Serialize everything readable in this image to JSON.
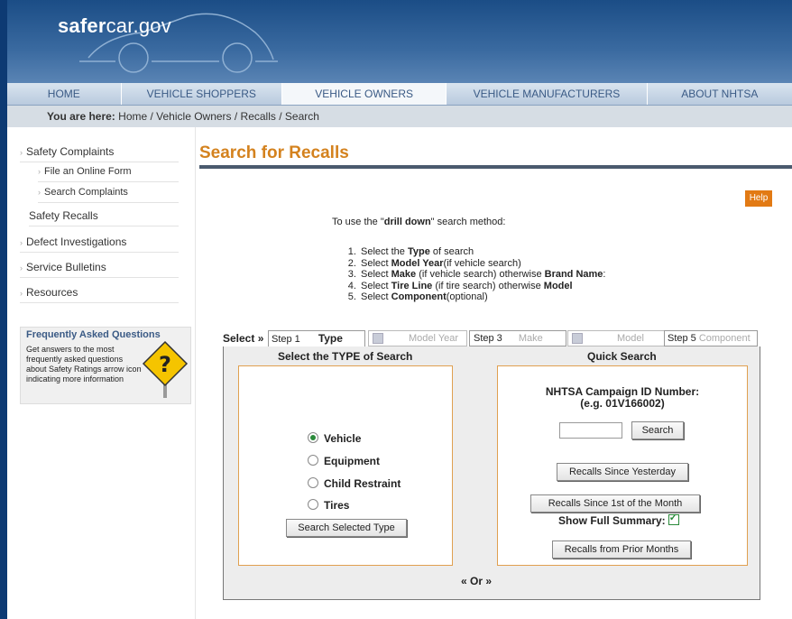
{
  "logo": {
    "bold": "safer",
    "rest": "car.gov"
  },
  "nav": [
    "HOME",
    "VEHICLE SHOPPERS",
    "VEHICLE OWNERS",
    "VEHICLE MANUFACTURERS",
    "ABOUT NHTSA"
  ],
  "breadcrumb": {
    "prefix": "You are here:",
    "path": "Home / Vehicle Owners / Recalls / Search"
  },
  "sidebar": {
    "items": [
      "Safety Complaints",
      "File an Online Form",
      "Search Complaints",
      "Safety Recalls",
      "Defect Investigations",
      "Service Bulletins",
      "Resources"
    ]
  },
  "faq": {
    "title": "Frequently Asked Questions",
    "text": "Get answers to the most frequently asked questions about Safety Ratings arrow icon indicating more information"
  },
  "page": {
    "title": "Search for Recalls",
    "help": "Help",
    "intro": {
      "before": "To use the \"",
      "bold": "drill down",
      "after": "\" search method:"
    },
    "steps": [
      [
        "Select the ",
        "Type",
        " of search"
      ],
      [
        "Select ",
        "Model Year",
        "(if vehicle search)"
      ],
      [
        "Select ",
        "Make",
        " (if vehicle search) otherwise ",
        "Brand Name",
        ":"
      ],
      [
        "Select ",
        "Tire Line",
        " (if tire search) otherwise ",
        "Model"
      ],
      [
        "Select ",
        "Component",
        "(optional)"
      ]
    ]
  },
  "wizard": {
    "select_label": "Select »",
    "tabs": {
      "step1": "Step 1",
      "type": "Type",
      "model_year": "Model Year",
      "step3": "Step 3",
      "make": "Make",
      "model": "Model",
      "step5": "Step 5",
      "component": "Component"
    }
  },
  "type_search": {
    "heading": "Select the TYPE of Search",
    "options": [
      "Vehicle",
      "Equipment",
      "Child Restraint",
      "Tires"
    ],
    "selected": "Vehicle",
    "button": "Search Selected Type"
  },
  "or_label": "« Or »",
  "quick_search": {
    "heading": "Quick Search",
    "campaign_label": "NHTSA Campaign ID Number:",
    "campaign_example": "(e.g. 01V166002)",
    "campaign_value": "",
    "search_button": "Search",
    "since_yesterday": "Recalls Since Yesterday",
    "since_month": "Recalls Since 1st of the Month",
    "show_summary": "Show Full Summary:",
    "show_summary_checked": true,
    "prior_months": "Recalls from Prior Months"
  }
}
